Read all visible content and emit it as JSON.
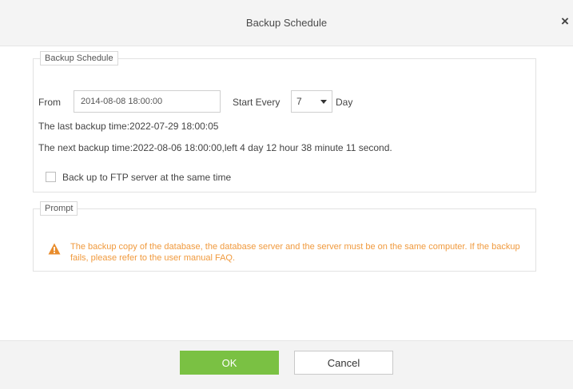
{
  "dialog": {
    "title": "Backup Schedule",
    "close_symbol": "×"
  },
  "schedule": {
    "legend": "Backup Schedule",
    "from_label": "From",
    "from_value": "2014-08-08 18:00:00",
    "start_every_label": "Start Every",
    "every_value": "7",
    "day_label": "Day",
    "last_backup": "The last backup time:2022-07-29 18:00:05",
    "next_backup": "The next backup time:2022-08-06 18:00:00,left 4 day 12 hour 38 minute 11 second.",
    "ftp_label": "Back up to FTP server at the same time",
    "ftp_checked": false
  },
  "prompt": {
    "legend": "Prompt",
    "message": "The backup copy of the database, the database server and the server must be on the same computer. If the backup fails, please refer to the user manual FAQ.",
    "warning_color": "#f09a3e",
    "icon": "warning-icon"
  },
  "footer": {
    "ok_label": "OK",
    "cancel_label": "Cancel",
    "ok_color": "#7ac143"
  }
}
